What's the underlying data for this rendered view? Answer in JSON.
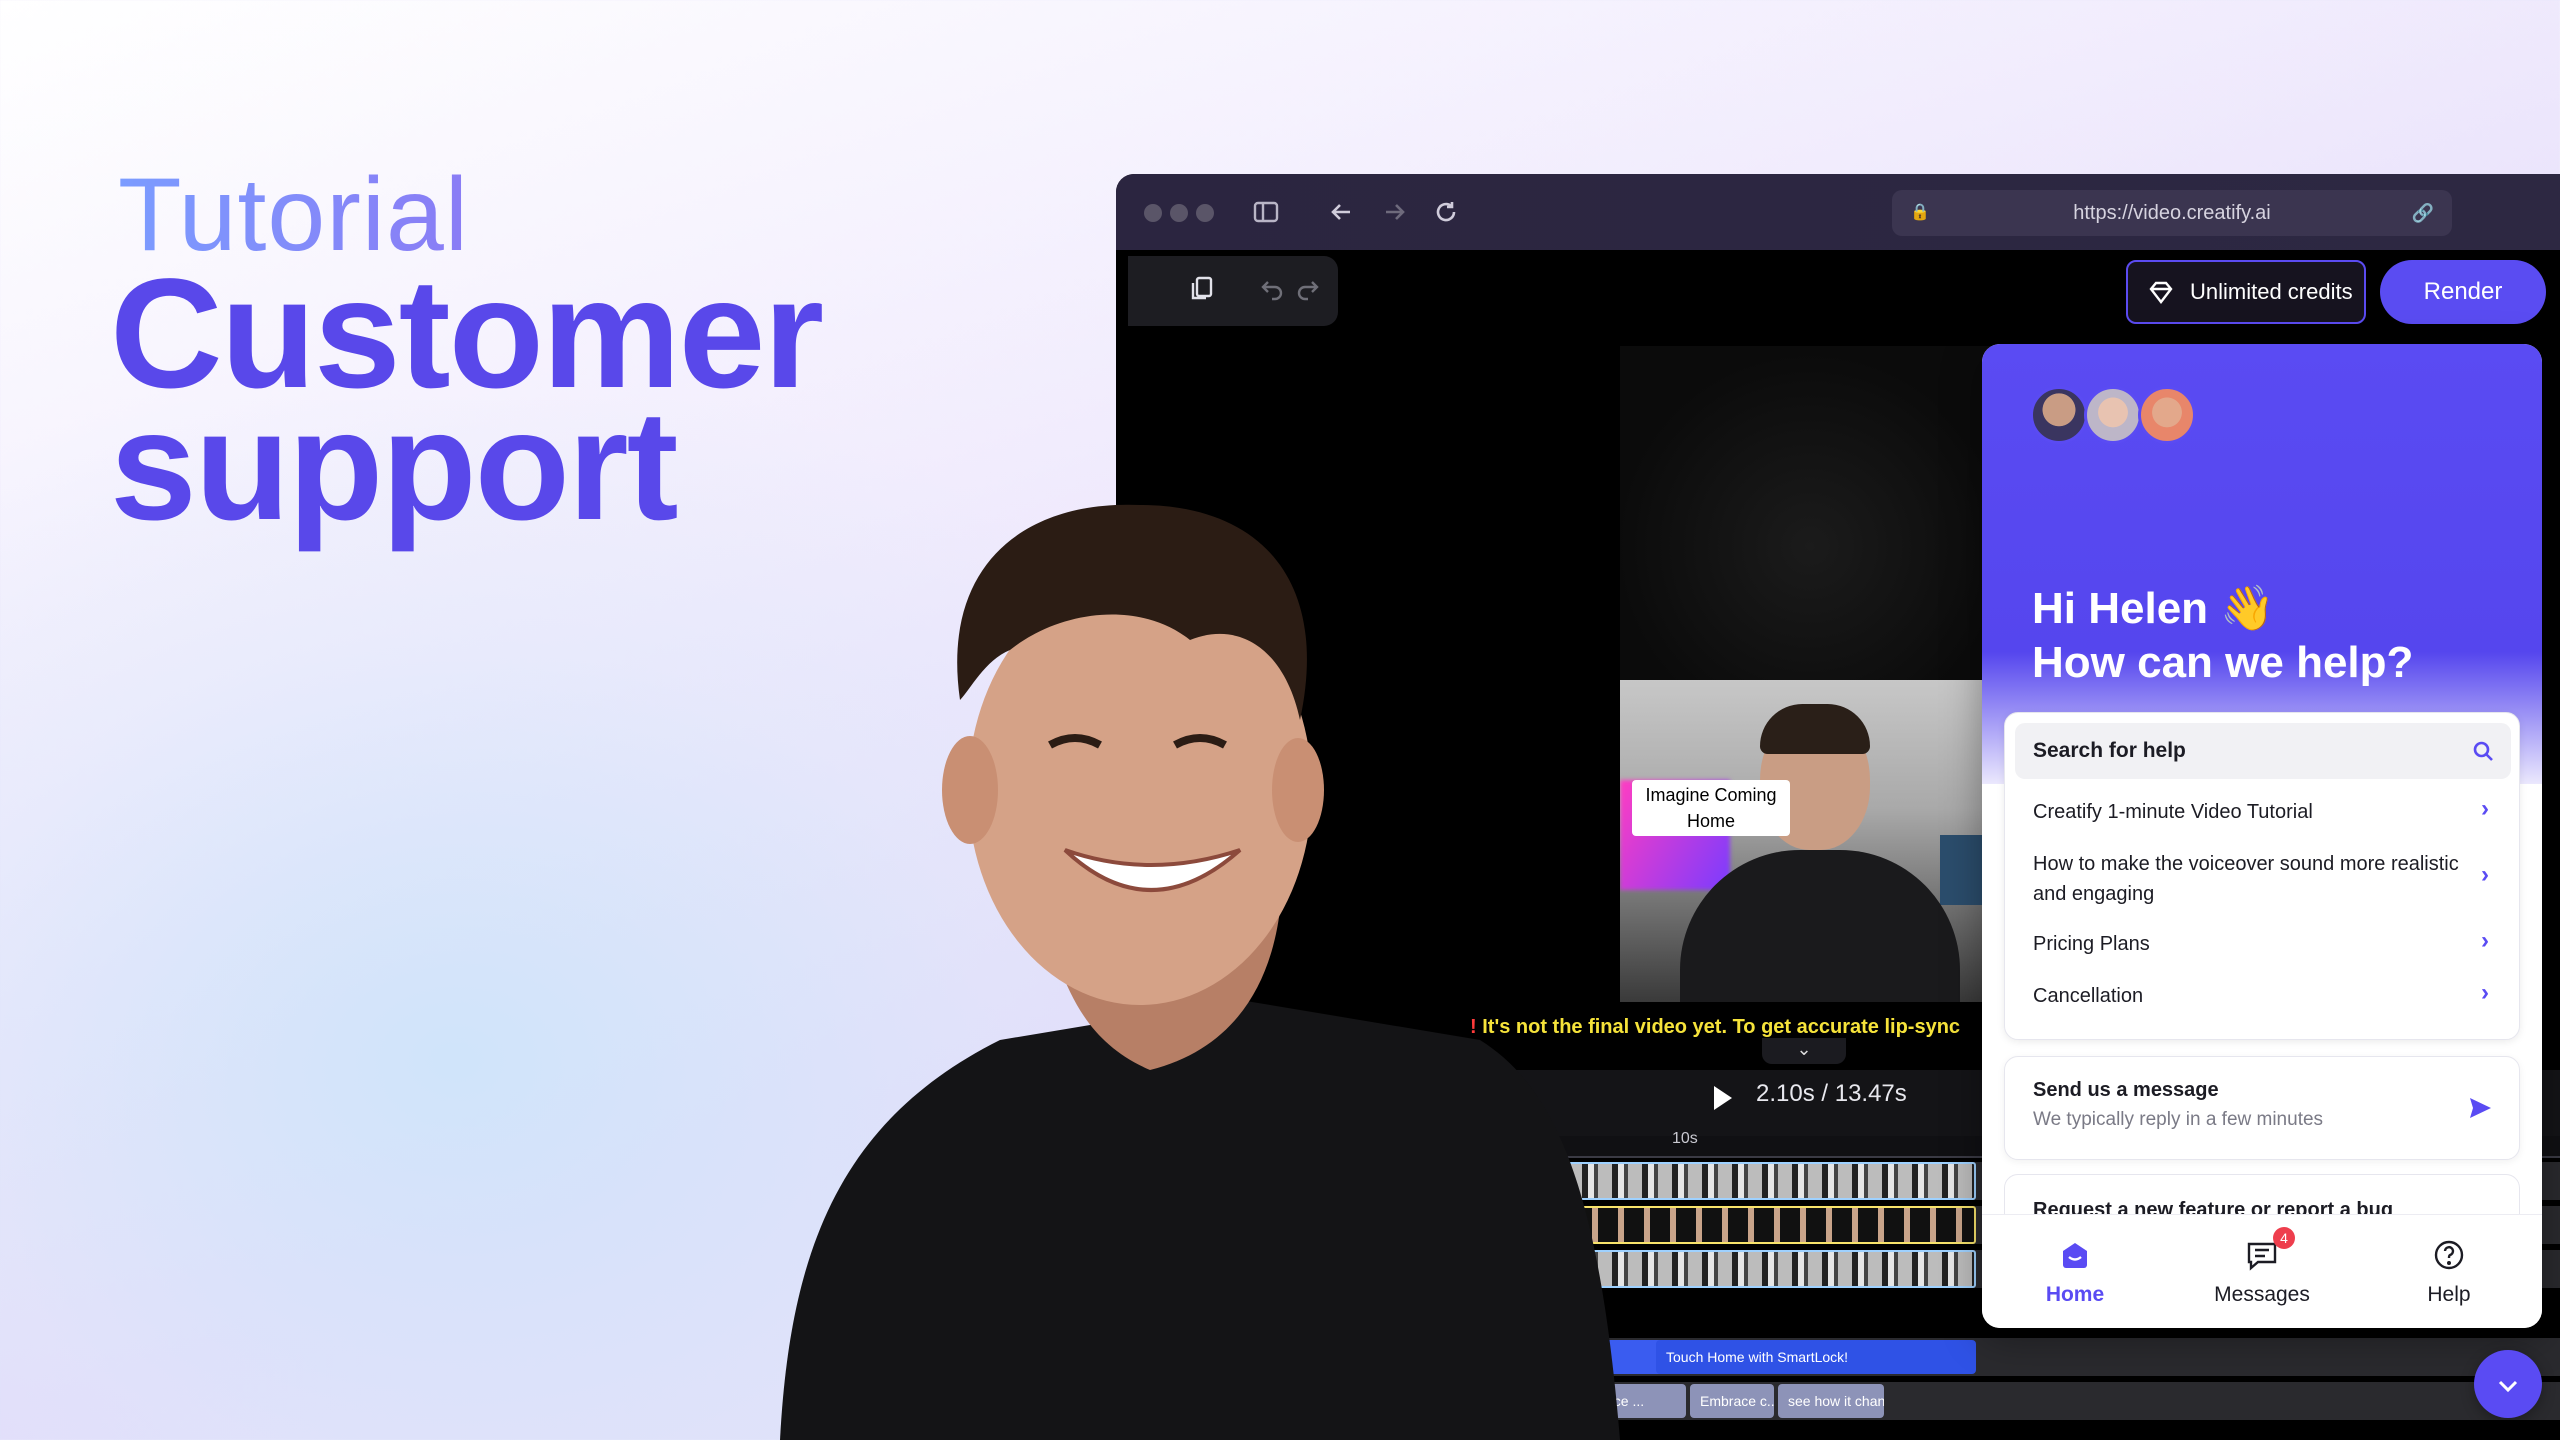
{
  "hero": {
    "eyebrow": "Tutorial",
    "title": "Customer support"
  },
  "browser": {
    "url": "https://video.creatify.ai"
  },
  "editor": {
    "credits_label": "Unlimited credits",
    "render_label": "Render",
    "caption": "Imagine Coming Home",
    "warning": "It's not the final video yet. To get accurate lip-sync",
    "warning_mark": "!",
    "time": "2.10s / 13.47s",
    "ruler_label": "10s",
    "text_clips": [
      "Touch Home with SmartLock!",
      "nce ...",
      "Embrace c...",
      "see how it chan..."
    ]
  },
  "widget": {
    "greeting_line1": "Hi Helen 👋",
    "greeting_line2": "How can we help?",
    "search_placeholder": "Search for help",
    "help_items": [
      "Creatify 1-minute Video Tutorial",
      "How to make the voiceover sound more realistic and engaging",
      "Pricing Plans",
      "Cancellation"
    ],
    "message_title": "Send us a message",
    "message_subtitle": "We typically reply in a few minutes",
    "feature_title": "Request a new feature or report a bug",
    "tabs": [
      {
        "label": "Home",
        "icon": "home-icon"
      },
      {
        "label": "Messages",
        "icon": "messages-icon",
        "badge": "4"
      },
      {
        "label": "Help",
        "icon": "help-icon"
      }
    ]
  },
  "colors": {
    "accent": "#5A4BF3",
    "hero_title": "#5948EA",
    "warning": "#F6E33A"
  }
}
